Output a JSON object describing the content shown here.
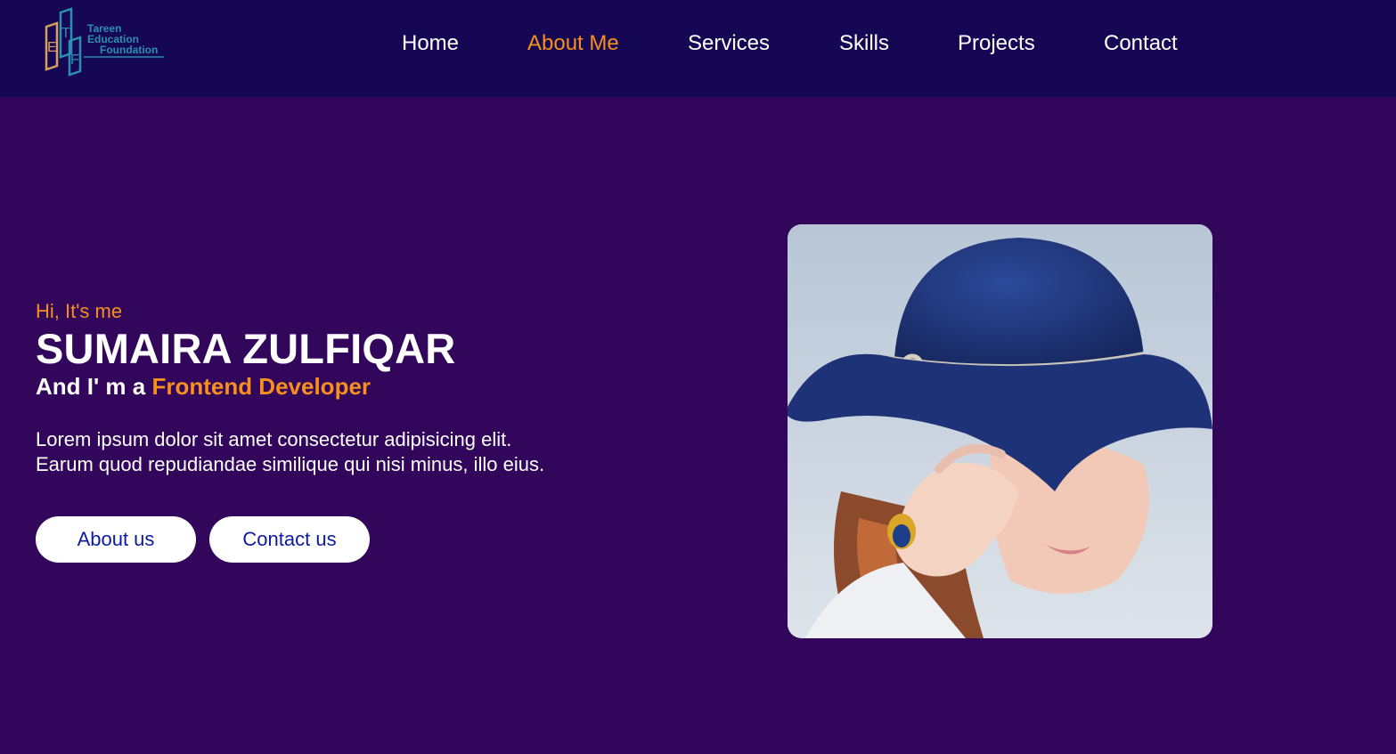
{
  "logo": {
    "letters": [
      "E",
      "T",
      "F"
    ],
    "lines": [
      "Tareen",
      "Education",
      "Foundation"
    ]
  },
  "nav": {
    "items": [
      {
        "label": "Home",
        "active": false
      },
      {
        "label": "About Me",
        "active": true
      },
      {
        "label": "Services",
        "active": false
      },
      {
        "label": "Skills",
        "active": false
      },
      {
        "label": "Projects",
        "active": false
      },
      {
        "label": "Contact",
        "active": false
      }
    ]
  },
  "hero": {
    "greeting": "Hi, It's me",
    "name": "SUMAIRA ZULFIQAR",
    "role_prefix": "And I' m a",
    "role_highlight": "Frontend Developer",
    "description_line1": "Lorem ipsum dolor sit amet consectetur adipisicing elit.",
    "description_line2": "Earum quod repudiandae similique qui nisi minus, illo eius.",
    "buttons": {
      "about": "About us",
      "contact": "Contact us"
    }
  },
  "colors": {
    "nav_bg": "#160755",
    "page_bg": "#31065b",
    "accent": "#f7901e",
    "button_text": "#0b1aa0",
    "white": "#ffffff"
  }
}
